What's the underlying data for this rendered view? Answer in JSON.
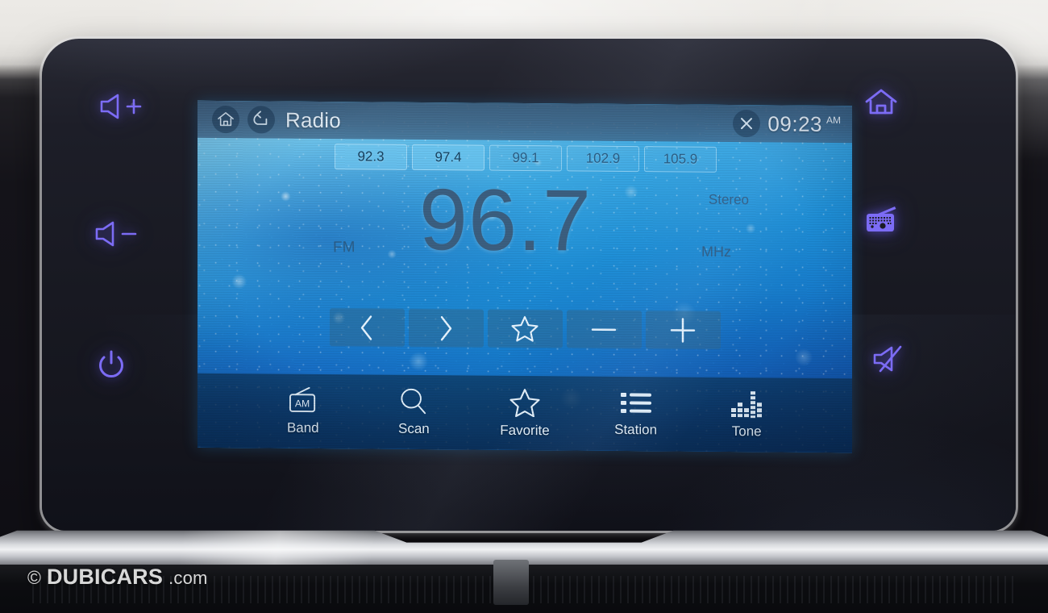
{
  "device": {
    "type": "car-infotainment-head-unit",
    "hardkeys_left": [
      {
        "name": "volume-up",
        "icon": "speaker-plus-icon",
        "label": ""
      },
      {
        "name": "volume-down",
        "icon": "speaker-minus-icon",
        "label": ""
      },
      {
        "name": "power",
        "icon": "power-icon",
        "label": ""
      }
    ],
    "hardkeys_right": [
      {
        "name": "home",
        "icon": "home-icon",
        "label": ""
      },
      {
        "name": "radio",
        "icon": "radio-icon",
        "label": ""
      },
      {
        "name": "mute",
        "icon": "speaker-mute-icon",
        "label": ""
      }
    ],
    "backlight_color": "#7c6cf5"
  },
  "titlebar": {
    "home_icon": "home-icon",
    "back_icon": "back-arrow-icon",
    "title": "Radio",
    "close_icon": "close-x-icon",
    "time": "09:23",
    "ampm": "AM"
  },
  "presets": [
    {
      "label": "92.3",
      "state": "active"
    },
    {
      "label": "97.4",
      "state": "active"
    },
    {
      "label": "99.1",
      "state": "dim"
    },
    {
      "label": "102.9",
      "state": "dim"
    },
    {
      "label": "105.9",
      "state": "dim"
    }
  ],
  "tuner": {
    "band": "FM",
    "frequency": "96.7",
    "unit": "MHz",
    "stereo": "Stereo"
  },
  "controls": [
    {
      "name": "seek-down",
      "icon": "chevron-left-icon"
    },
    {
      "name": "seek-up",
      "icon": "chevron-right-icon"
    },
    {
      "name": "save-favorite",
      "icon": "star-icon"
    },
    {
      "name": "tune-down",
      "icon": "minus-icon"
    },
    {
      "name": "tune-up",
      "icon": "plus-icon"
    }
  ],
  "bottom_nav": [
    {
      "label": "Band",
      "icon": "am-radio-icon"
    },
    {
      "label": "Scan",
      "icon": "search-icon"
    },
    {
      "label": "Favorite",
      "icon": "star-icon"
    },
    {
      "label": "Station",
      "icon": "list-icon"
    },
    {
      "label": "Tone",
      "icon": "equalizer-icon"
    }
  ],
  "watermark": {
    "copyright": "©",
    "brand": "DUBICARS",
    "tld": ".com"
  }
}
